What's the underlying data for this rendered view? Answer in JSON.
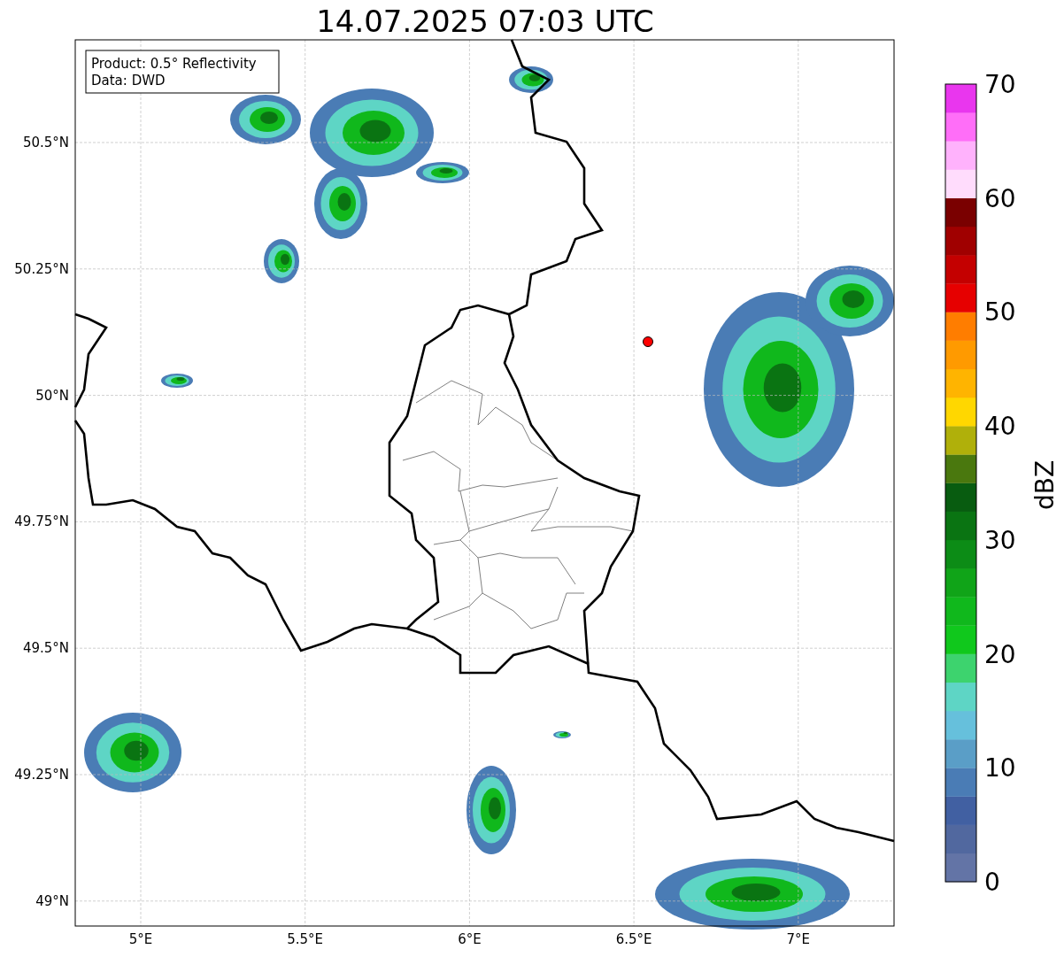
{
  "title": "14.07.2025 07:03 UTC",
  "info_box": {
    "lines": [
      "Product: 0.5° Reflectivity",
      "Data: DWD"
    ]
  },
  "x_ticks": [
    "5°E",
    "5.5°E",
    "6°E",
    "6.5°E",
    "7°E"
  ],
  "y_ticks": [
    "50.5°N",
    "50.25°N",
    "50°N",
    "49.75°N",
    "49.5°N",
    "49.25°N",
    "49°N"
  ],
  "colorbar": {
    "label": "dBZ",
    "ticks": [
      "70",
      "60",
      "50",
      "40",
      "30",
      "20",
      "10",
      "0"
    ],
    "bins": [
      {
        "color": "#6374a6"
      },
      {
        "color": "#51689f"
      },
      {
        "color": "#4160a2"
      },
      {
        "color": "#4a7cb5"
      },
      {
        "color": "#5a9ec7"
      },
      {
        "color": "#66c0dc"
      },
      {
        "color": "#5ed5c5"
      },
      {
        "color": "#3dd36e"
      },
      {
        "color": "#10c81c"
      },
      {
        "color": "#10b81c"
      },
      {
        "color": "#10a418"
      },
      {
        "color": "#0c8c16"
      },
      {
        "color": "#0a7412"
      },
      {
        "color": "#085c10"
      },
      {
        "color": "#4a780e"
      },
      {
        "color": "#b0b00a"
      },
      {
        "color": "#ffd700"
      },
      {
        "color": "#ffb400"
      },
      {
        "color": "#ff9a00"
      },
      {
        "color": "#ff7d00"
      },
      {
        "color": "#e60000"
      },
      {
        "color": "#c40000"
      },
      {
        "color": "#a00000"
      },
      {
        "color": "#7a0000"
      },
      {
        "color": "#ffdcfc"
      },
      {
        "color": "#ffb2fc"
      },
      {
        "color": "#ff6ef8"
      },
      {
        "color": "#e936ee"
      }
    ]
  }
}
